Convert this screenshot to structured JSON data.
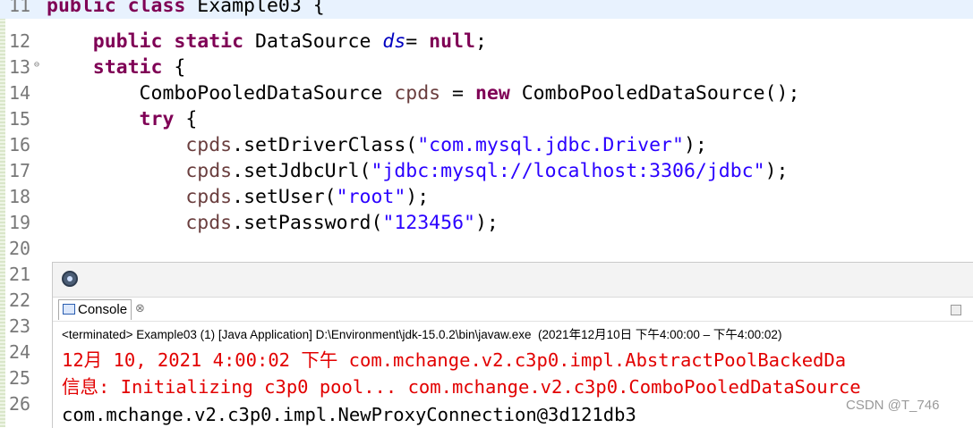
{
  "editor": {
    "lines": [
      {
        "number": "11",
        "parts": [
          {
            "t": "public class ",
            "c": "kw"
          },
          {
            "t": "Example03 {",
            "c": "plain"
          }
        ]
      },
      {
        "number": "12",
        "parts": [
          {
            "t": "    public static ",
            "c": "kw"
          },
          {
            "t": "DataSource ",
            "c": "plain"
          },
          {
            "t": "ds",
            "c": "fld"
          },
          {
            "t": "= ",
            "c": "plain"
          },
          {
            "t": "null",
            "c": "kw"
          },
          {
            "t": ";",
            "c": "plain"
          }
        ]
      },
      {
        "number": "13",
        "fold": "⊖",
        "parts": [
          {
            "t": "    static ",
            "c": "kw"
          },
          {
            "t": "{",
            "c": "plain"
          }
        ]
      },
      {
        "number": "14",
        "parts": [
          {
            "t": "        ComboPooledDataSource ",
            "c": "plain"
          },
          {
            "t": "cpds",
            "c": "var"
          },
          {
            "t": " = ",
            "c": "plain"
          },
          {
            "t": "new ",
            "c": "kw"
          },
          {
            "t": "ComboPooledDataSource();",
            "c": "plain"
          }
        ]
      },
      {
        "number": "15",
        "parts": [
          {
            "t": "        try ",
            "c": "kw"
          },
          {
            "t": "{",
            "c": "plain"
          }
        ]
      },
      {
        "number": "16",
        "parts": [
          {
            "t": "            ",
            "c": "plain"
          },
          {
            "t": "cpds",
            "c": "var"
          },
          {
            "t": ".setDriverClass(",
            "c": "plain"
          },
          {
            "t": "\"com.mysql.jdbc.Driver\"",
            "c": "str"
          },
          {
            "t": ");",
            "c": "plain"
          }
        ]
      },
      {
        "number": "17",
        "parts": [
          {
            "t": "            ",
            "c": "plain"
          },
          {
            "t": "cpds",
            "c": "var"
          },
          {
            "t": ".setJdbcUrl(",
            "c": "plain"
          },
          {
            "t": "\"jdbc:mysql://localhost:3306/jdbc\"",
            "c": "str"
          },
          {
            "t": ");",
            "c": "plain"
          }
        ]
      },
      {
        "number": "18",
        "parts": [
          {
            "t": "            ",
            "c": "plain"
          },
          {
            "t": "cpds",
            "c": "var"
          },
          {
            "t": ".setUser(",
            "c": "plain"
          },
          {
            "t": "\"root\"",
            "c": "str"
          },
          {
            "t": ");",
            "c": "plain"
          }
        ]
      },
      {
        "number": "19",
        "parts": [
          {
            "t": "            ",
            "c": "plain"
          },
          {
            "t": "cpds",
            "c": "var"
          },
          {
            "t": ".setPassword(",
            "c": "plain"
          },
          {
            "t": "\"123456\"",
            "c": "str"
          },
          {
            "t": ");",
            "c": "plain"
          }
        ]
      },
      {
        "number": "20",
        "parts": []
      },
      {
        "number": "21",
        "parts": []
      },
      {
        "number": "22",
        "parts": []
      },
      {
        "number": "23",
        "parts": []
      },
      {
        "number": "24",
        "parts": []
      },
      {
        "number": "25",
        "parts": []
      },
      {
        "number": "26",
        "parts": []
      }
    ]
  },
  "console": {
    "toolbar_icon": "eclipse-icon",
    "tab_label": "Console",
    "tab_icon": "console-icon",
    "tab_close": "⊗",
    "status": "<terminated> Example03 (1) [Java Application] D:\\Environment\\jdk-15.0.2\\bin\\javaw.exe  (2021年12月10日 下午4:00:00 – 下午4:00:02)",
    "output": [
      {
        "text": "12月 10, 2021 4:00:02 下午 com.mchange.v2.c3p0.impl.AbstractPoolBackedDa",
        "color": "red"
      },
      {
        "text": "信息: Initializing c3p0 pool... com.mchange.v2.c3p0.ComboPooledDataSource",
        "color": "red"
      },
      {
        "text": "com.mchange.v2.c3p0.impl.NewProxyConnection@3d121db3",
        "color": "black"
      }
    ]
  },
  "watermark": "CSDN @T_746"
}
